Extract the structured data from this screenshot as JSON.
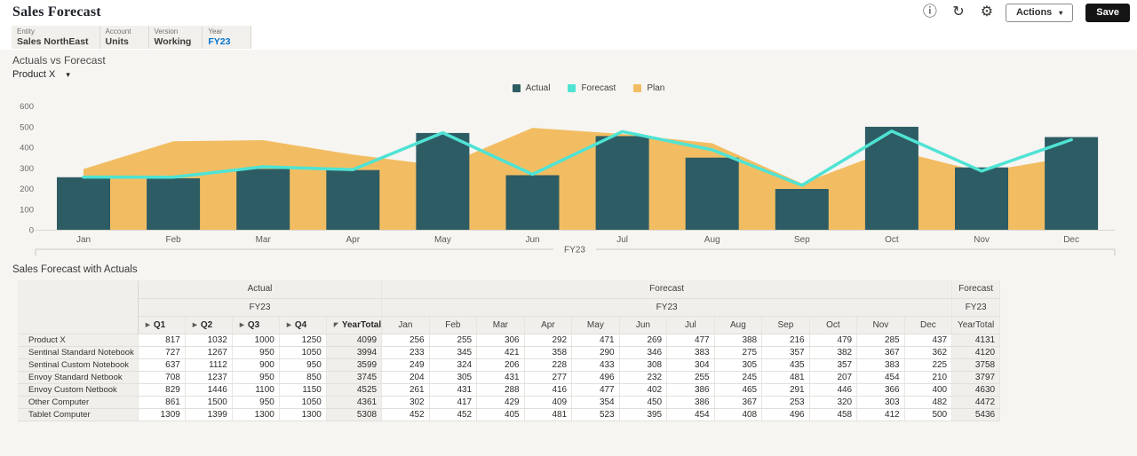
{
  "app": {
    "title": "Sales Forecast",
    "toolbar": {
      "actions_label": "Actions",
      "save_label": "Save",
      "icon_glyphs": {
        "info": "ⓘ",
        "refresh": "↻",
        "settings": "⚙"
      }
    }
  },
  "icons": {
    "caret_down": "▾",
    "expand": "▶",
    "collapse": "◤"
  },
  "pov": {
    "items": [
      {
        "dimension": "Entity",
        "member": "Sales NorthEast"
      },
      {
        "dimension": "Account",
        "member": "Units"
      },
      {
        "dimension": "Version",
        "member": "Working"
      },
      {
        "dimension": "Year",
        "member": "FY23"
      }
    ]
  },
  "chart": {
    "title": "Actuals vs Forecast",
    "selector": "Product X",
    "legend": [
      {
        "label": "Actual",
        "color": "#2e5c64"
      },
      {
        "label": "Forecast",
        "color": "#4fe3d4"
      },
      {
        "label": "Plan",
        "color": "#f2bd62"
      }
    ]
  },
  "chart_data": {
    "type": "combo",
    "categories": [
      "Jan",
      "Feb",
      "Mar",
      "Apr",
      "May",
      "Jun",
      "Jul",
      "Aug",
      "Sep",
      "Oct",
      "Nov",
      "Dec"
    ],
    "x_group_label": "FY23",
    "ylim": [
      0,
      600
    ],
    "yticks": [
      0,
      100,
      200,
      300,
      400,
      500,
      600
    ],
    "grid": false,
    "legend_position": "top-center",
    "series": [
      {
        "name": "Actual",
        "type": "bar",
        "color": "#2e5c64",
        "values": [
          255,
          250,
          295,
          290,
          470,
          265,
          455,
          350,
          198,
          500,
          303,
          450
        ]
      },
      {
        "name": "Forecast",
        "type": "line",
        "color": "#4fe3d4",
        "values": [
          256,
          255,
          306,
          292,
          471,
          269,
          477,
          388,
          216,
          479,
          285,
          437
        ]
      },
      {
        "name": "Plan",
        "type": "area",
        "color": "#f2bd62",
        "values": [
          295,
          430,
          435,
          365,
          310,
          495,
          465,
          420,
          225,
          390,
          280,
          355
        ]
      }
    ]
  },
  "table": {
    "title": "Sales Forecast with Actuals",
    "groups": [
      {
        "label": "Actual",
        "year": "FY23",
        "cols": 5
      },
      {
        "label": "Forecast",
        "year": "FY23",
        "cols": 12
      },
      {
        "label": "Forecast",
        "year": "FY23",
        "cols": 1
      }
    ],
    "quarter_headers": [
      "Q1",
      "Q2",
      "Q3",
      "Q4"
    ],
    "yeartotal_header": "YearTotal",
    "month_headers": [
      "Jan",
      "Feb",
      "Mar",
      "Apr",
      "May",
      "Jun",
      "Jul",
      "Aug",
      "Sep",
      "Oct",
      "Nov",
      "Dec"
    ],
    "rows": [
      {
        "label": "Product X",
        "actual": [
          817,
          1032,
          1000,
          1250
        ],
        "actual_total": 4099,
        "forecast": [
          256,
          255,
          306,
          292,
          471,
          269,
          477,
          388,
          216,
          479,
          285,
          437
        ],
        "forecast_total": 4131
      },
      {
        "label": "Sentinal Standard Notebook",
        "actual": [
          727,
          1267,
          950,
          1050
        ],
        "actual_total": 3994,
        "forecast": [
          233,
          345,
          421,
          358,
          290,
          346,
          383,
          275,
          357,
          382,
          367,
          362
        ],
        "forecast_total": 4120
      },
      {
        "label": "Sentinal Custom Notebook",
        "actual": [
          637,
          1112,
          900,
          950
        ],
        "actual_total": 3599,
        "forecast": [
          249,
          324,
          206,
          228,
          433,
          308,
          304,
          305,
          435,
          357,
          383,
          225
        ],
        "forecast_total": 3758
      },
      {
        "label": "Envoy Standard Netbook",
        "actual": [
          708,
          1237,
          950,
          850
        ],
        "actual_total": 3745,
        "forecast": [
          204,
          305,
          431,
          277,
          496,
          232,
          255,
          245,
          481,
          207,
          454,
          210
        ],
        "forecast_total": 3797
      },
      {
        "label": "Envoy Custom Netbook",
        "actual": [
          829,
          1446,
          1100,
          1150
        ],
        "actual_total": 4525,
        "forecast": [
          261,
          431,
          288,
          416,
          477,
          402,
          386,
          465,
          291,
          446,
          366,
          400
        ],
        "forecast_total": 4630
      },
      {
        "label": "Other Computer",
        "actual": [
          861,
          1500,
          950,
          1050
        ],
        "actual_total": 4361,
        "forecast": [
          302,
          417,
          429,
          409,
          354,
          450,
          386,
          367,
          253,
          320,
          303,
          482
        ],
        "forecast_total": 4472
      },
      {
        "label": "Tablet Computer",
        "actual": [
          1309,
          1399,
          1300,
          1300
        ],
        "actual_total": 5308,
        "forecast": [
          452,
          452,
          405,
          481,
          523,
          395,
          454,
          408,
          496,
          458,
          412,
          500
        ],
        "forecast_total": 5436
      }
    ]
  }
}
